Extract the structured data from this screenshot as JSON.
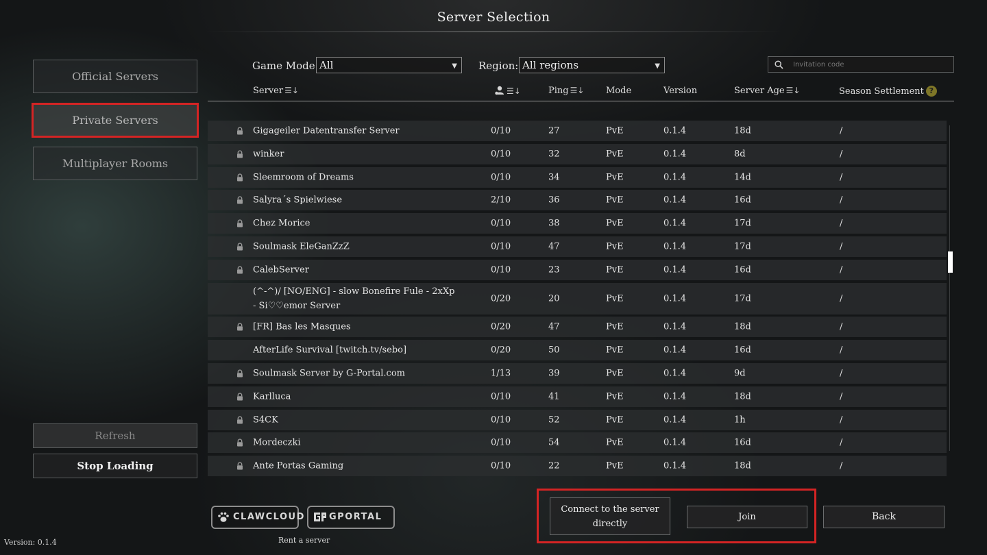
{
  "title": "Server Selection",
  "nav": {
    "official": "Official Servers",
    "private": "Private Servers",
    "multiplayer": "Multiplayer Rooms"
  },
  "actions": {
    "refresh": "Refresh",
    "stop": "Stop Loading"
  },
  "version": "Version: 0.1.4",
  "filters": {
    "game_mode_label": "Game Mode",
    "game_mode_value": "All",
    "region_label": "Region:",
    "region_value": "All regions",
    "invitation_placeholder": "Invitation code"
  },
  "columns": {
    "server": "Server",
    "ping": "Ping",
    "mode": "Mode",
    "version": "Version",
    "server_age": "Server Age",
    "season": "Season Settlement",
    "help": "?"
  },
  "rows": [
    {
      "locked": true,
      "name": "Gigageiler Datentransfer Server",
      "players": "0/10",
      "ping": "27",
      "mode": "PvE",
      "version": "0.1.4",
      "age": "18d",
      "season": "/"
    },
    {
      "locked": true,
      "name": "winker",
      "players": "0/10",
      "ping": "32",
      "mode": "PvE",
      "version": "0.1.4",
      "age": "8d",
      "season": "/"
    },
    {
      "locked": true,
      "name": "Sleemroom of Dreams",
      "players": "0/10",
      "ping": "34",
      "mode": "PvE",
      "version": "0.1.4",
      "age": "14d",
      "season": "/"
    },
    {
      "locked": true,
      "name": "Salyra´s Spielwiese",
      "players": "2/10",
      "ping": "36",
      "mode": "PvE",
      "version": "0.1.4",
      "age": "16d",
      "season": "/"
    },
    {
      "locked": true,
      "name": "Chez Morice",
      "players": "0/10",
      "ping": "38",
      "mode": "PvE",
      "version": "0.1.4",
      "age": "17d",
      "season": "/"
    },
    {
      "locked": true,
      "name": "Soulmask EleGanZzZ",
      "players": "0/10",
      "ping": "47",
      "mode": "PvE",
      "version": "0.1.4",
      "age": "17d",
      "season": "/"
    },
    {
      "locked": true,
      "name": "CalebServer",
      "players": "0/10",
      "ping": "23",
      "mode": "PvE",
      "version": "0.1.4",
      "age": "16d",
      "season": "/"
    },
    {
      "locked": false,
      "name": "(^-^)/ [NO/ENG] - slow Bonefire Fule - 2xXp - Si♡♡emor Server",
      "players": "0/20",
      "ping": "20",
      "mode": "PvE",
      "version": "0.1.4",
      "age": "17d",
      "season": "/",
      "tall": true
    },
    {
      "locked": true,
      "name": "[FR] Bas les Masques",
      "players": "0/20",
      "ping": "47",
      "mode": "PvE",
      "version": "0.1.4",
      "age": "18d",
      "season": "/"
    },
    {
      "locked": false,
      "name": "AfterLife Survival [twitch.tv/sebo]",
      "players": "0/20",
      "ping": "50",
      "mode": "PvE",
      "version": "0.1.4",
      "age": "16d",
      "season": "/"
    },
    {
      "locked": true,
      "name": "Soulmask Server by G-Portal.com",
      "players": "1/13",
      "ping": "39",
      "mode": "PvE",
      "version": "0.1.4",
      "age": "9d",
      "season": "/"
    },
    {
      "locked": true,
      "name": "Karlluca",
      "players": "0/10",
      "ping": "41",
      "mode": "PvE",
      "version": "0.1.4",
      "age": "18d",
      "season": "/"
    },
    {
      "locked": true,
      "name": "S4CK",
      "players": "0/10",
      "ping": "52",
      "mode": "PvE",
      "version": "0.1.4",
      "age": "1h",
      "season": "/"
    },
    {
      "locked": true,
      "name": "Mordeczki",
      "players": "0/10",
      "ping": "54",
      "mode": "PvE",
      "version": "0.1.4",
      "age": "16d",
      "season": "/"
    },
    {
      "locked": true,
      "name": "Ante Portas Gaming",
      "players": "0/10",
      "ping": "22",
      "mode": "PvE",
      "version": "0.1.4",
      "age": "18d",
      "season": "/"
    }
  ],
  "partners": {
    "clawcloud": "CLAWCLOUD",
    "gportal": "GPORTAL",
    "rent": "Rent a server"
  },
  "buttons": {
    "connect": "Connect to the server directly",
    "join": "Join",
    "back": "Back"
  }
}
